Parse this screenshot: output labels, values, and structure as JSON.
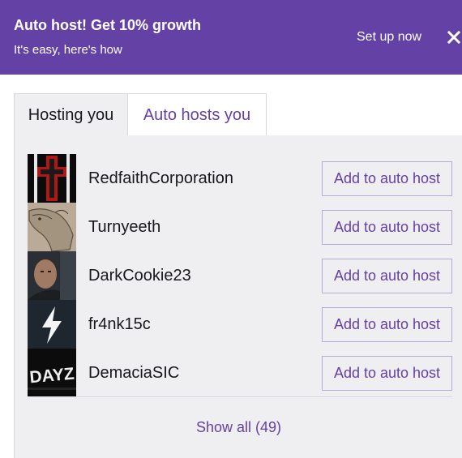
{
  "banner": {
    "title": "Auto host! Get 10% growth",
    "subtitle": "It's easy, here's how",
    "cta": "Set up now",
    "close_icon": "close-icon",
    "color": "#6441a5"
  },
  "tabs": [
    {
      "label": "Hosting you",
      "active": true
    },
    {
      "label": "Auto hosts you",
      "active": false
    }
  ],
  "channels": [
    {
      "name": "RedfaithCorporation",
      "button": "Add to auto host",
      "avatar": "red-cross-avatar"
    },
    {
      "name": "Turnyeeth",
      "button": "Add to auto host",
      "avatar": "horse-sketch-avatar"
    },
    {
      "name": "DarkCookie23",
      "button": "Add to auto host",
      "avatar": "portrait-avatar"
    },
    {
      "name": "fr4nk15c",
      "button": "Add to auto host",
      "avatar": "lightning-avatar"
    },
    {
      "name": "DemaciaSIC",
      "button": "Add to auto host",
      "avatar": "dayz-logo-avatar",
      "avatar_text": "DAYZ"
    }
  ],
  "show_all": "Show all (49)",
  "colors": {
    "accent": "#6441a5",
    "panel": "#efeef1",
    "border": "#dad8de"
  }
}
